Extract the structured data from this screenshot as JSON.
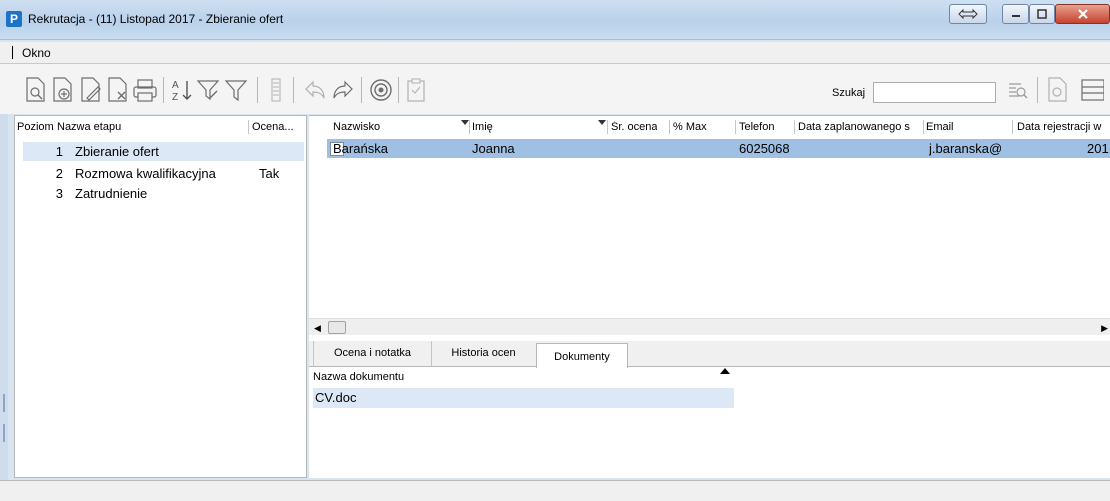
{
  "window": {
    "title": "Rekrutacja - (11) Listopad 2017 - Zbieranie ofert",
    "app_icon_letter": "P"
  },
  "menu": {
    "items": [
      "Okno"
    ]
  },
  "toolbar": {
    "search_label": "Szukaj",
    "search_value": "",
    "icons": [
      "preview-document-icon",
      "add-document-icon",
      "edit-document-icon",
      "delete-document-icon",
      "print-icon",
      "sort-az-icon",
      "filter-edit-icon",
      "filter-icon",
      "list-icon",
      "undo-icon",
      "redo-icon",
      "target-icon",
      "clipboard-icon",
      "search-list-icon",
      "document-preview-icon",
      "layout-icon"
    ]
  },
  "stages": {
    "headers": {
      "poziom": "Poziom",
      "nazwa": "Nazwa etapu",
      "ocena": "Ocena..."
    },
    "rows": [
      {
        "poziom": "1",
        "nazwa": "Zbieranie ofert",
        "ocena": "",
        "selected": true
      },
      {
        "poziom": "2",
        "nazwa": "Rozmowa kwalifikacyjna",
        "ocena": "Tak",
        "selected": false
      },
      {
        "poziom": "3",
        "nazwa": "Zatrudnienie",
        "ocena": "",
        "selected": false
      }
    ]
  },
  "candidates": {
    "headers": {
      "nazwisko": "Nazwisko",
      "imie": "Imię",
      "sr_ocena": "Śr. ocena",
      "max": "% Max",
      "telefon": "Telefon",
      "data_zapl": "Data zaplanowanego s",
      "email": "Email",
      "data_rej": "Data rejestracji w"
    },
    "rows": [
      {
        "nazwisko": "Barańska",
        "imie": "Joanna",
        "telefon": "6025068",
        "email": "j.baranska@",
        "data_rej": "201",
        "selected": true,
        "checked": false
      }
    ]
  },
  "tabs": [
    {
      "label": "Ocena i notatka",
      "active": false
    },
    {
      "label": "Historia ocen",
      "active": false
    },
    {
      "label": "Dokumenty",
      "active": true
    }
  ],
  "documents": {
    "header": "Nazwa dokumentu",
    "rows": [
      "CV.doc"
    ]
  },
  "colors": {
    "selection": "#9fc0e3",
    "row_highlight": "#dce8f5",
    "titlebar": "#c4d8ee"
  }
}
